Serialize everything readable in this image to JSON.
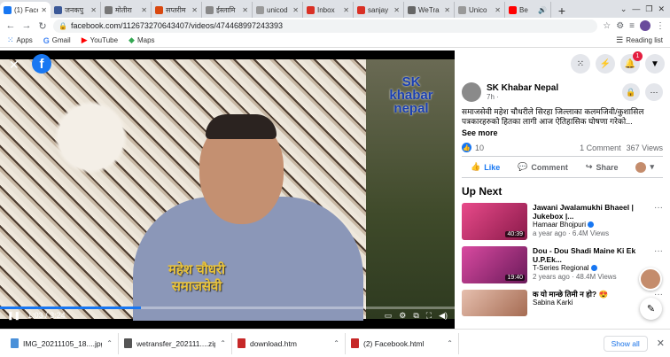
{
  "browser": {
    "tabs": [
      {
        "label": "(1) Face",
        "color": "#1877f2",
        "active": true
      },
      {
        "label": "जनकपु",
        "color": "#3b5998"
      },
      {
        "label": "मोतीरा",
        "color": "#777777"
      },
      {
        "label": "सप्तरीम",
        "color": "#d9480f"
      },
      {
        "label": "ईस्लामि",
        "color": "#888888"
      },
      {
        "label": "unicod",
        "color": "#999999"
      },
      {
        "label": "Inbox",
        "color": "#d93025"
      },
      {
        "label": "sanjay",
        "color": "#d93025"
      },
      {
        "label": "WeTra",
        "color": "#666666"
      },
      {
        "label": "Unico",
        "color": "#999999"
      },
      {
        "label": "Be",
        "color": "#ff0000"
      }
    ],
    "url": "facebook.com/112673270643407/videos/474468997243393",
    "bookmarks": [
      {
        "label": "Apps",
        "icon": "apps-grid-icon"
      },
      {
        "label": "Gmail",
        "icon": "google-icon"
      },
      {
        "label": "YouTube",
        "icon": "youtube-icon"
      },
      {
        "label": "Maps",
        "icon": "maps-icon"
      }
    ],
    "reading_list": "Reading list"
  },
  "video": {
    "watermark": "SK khabar nepal",
    "caption_line1": "महेश चौधरी",
    "caption_line2": "समाजसेवी",
    "time": "1:03 / 3:24",
    "progress": 0.31
  },
  "post": {
    "page_name": "SK Khabar Nepal",
    "time": "7h ·",
    "text": "समाजसेवी महेश चौधरीले सिरहा जिल्लाका कलमजिवी/कुशासिल पत्रकारहरुको हितका लागी आज ऐतिहासिक घोषणा गरेको...",
    "see_more": "See more",
    "likes": "10",
    "comments": "1 Comment",
    "views": "367 Views",
    "like_label": "Like",
    "comment_label": "Comment",
    "share_label": "Share"
  },
  "upnext": {
    "title": "Up Next",
    "videos": [
      {
        "title": "Jawani Jwalamukhi Bhaeel | Jukebox |...",
        "channel": "Hamaar Bhojpuri",
        "meta": "a year ago · 6.4M Views",
        "duration": "40:39",
        "color": "#c0306a"
      },
      {
        "title": "Dou - Dou Shadi Maine Ki Ek U.P.Ek...",
        "channel": "T-Series Regional",
        "meta": "2 years ago · 48.4M Views",
        "duration": "19:40",
        "color": "#b5267a"
      },
      {
        "title": "क यो मान्छे तिमी न हो? 😍",
        "channel": "Sabina Karki",
        "meta": "",
        "duration": "",
        "color": "#d9a18a"
      }
    ]
  },
  "downloads": [
    {
      "name": "IMG_20211105_18....jpg",
      "color": "#4a90d9"
    },
    {
      "name": "wetransfer_202111....zip",
      "color": "#555555"
    },
    {
      "name": "download.htm",
      "color": "#c62828"
    },
    {
      "name": "(2) Facebook.html",
      "color": "#c62828"
    }
  ],
  "show_all": "Show all",
  "notification_count": "1"
}
